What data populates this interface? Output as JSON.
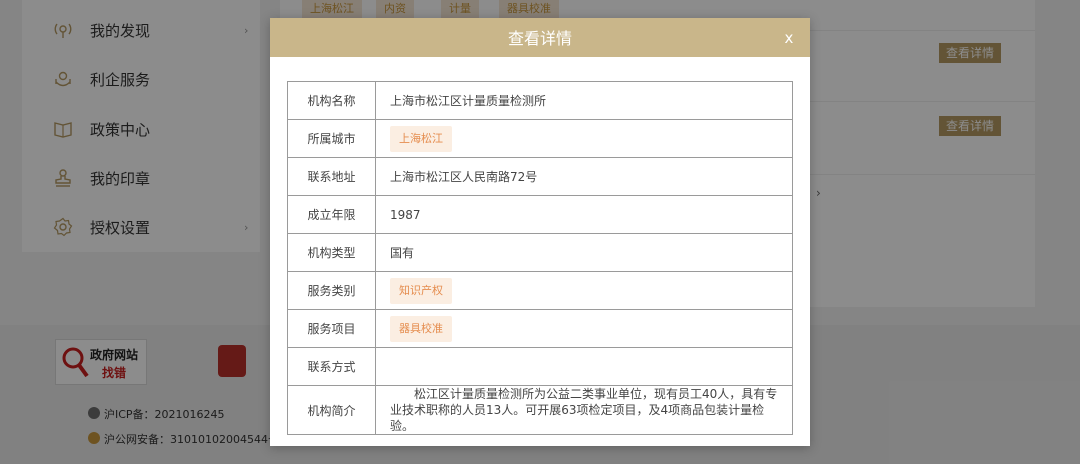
{
  "sidebar": {
    "items": [
      {
        "icon": "discover-icon",
        "label": "我的发现",
        "has_arrow": true
      },
      {
        "icon": "service-icon",
        "label": "利企服务",
        "has_arrow": false
      },
      {
        "icon": "policy-icon",
        "label": "政策中心",
        "has_arrow": false
      },
      {
        "icon": "stamp-icon",
        "label": "我的印章",
        "has_arrow": false
      },
      {
        "icon": "gear-icon",
        "label": "授权设置",
        "has_arrow": true
      }
    ],
    "arrow": "›"
  },
  "background": {
    "tags": [
      "上海松江",
      "内资",
      "计量",
      "器具校准"
    ],
    "detail_buttons": [
      "查看详情",
      "查看详情"
    ],
    "chevron": "›"
  },
  "footer": {
    "gov_badge_line1": "政府网站",
    "gov_badge_line2": "找错",
    "icp": "沪ICP备：2021016245",
    "police": "沪公网安备：31010102004544号"
  },
  "modal": {
    "title": "查看详情",
    "close": "x",
    "rows": [
      {
        "key": "机构名称",
        "value": "上海市松江区计量质量检测所",
        "type": "text"
      },
      {
        "key": "所属城市",
        "value": "上海松江",
        "type": "chip"
      },
      {
        "key": "联系地址",
        "value": "上海市松江区人民南路72号",
        "type": "text"
      },
      {
        "key": "成立年限",
        "value": "1987",
        "type": "text"
      },
      {
        "key": "机构类型",
        "value": "国有",
        "type": "text"
      },
      {
        "key": "服务类别",
        "value": "知识产权",
        "type": "chip"
      },
      {
        "key": "服务项目",
        "value": "器具校准",
        "type": "chip"
      },
      {
        "key": "联系方式",
        "value": "",
        "type": "text"
      },
      {
        "key": "机构简介",
        "value": "松江区计量质量检测所为公益二类事业单位，现有员工40人，具有专业技术职称的人员13人。可开展63项检定项目，及4项商品包装计量检验。",
        "type": "desc"
      }
    ]
  },
  "colors": {
    "modal_header": "#c9b68a",
    "detail_button": "#b59a63",
    "chip_bg": "#fbeee2",
    "chip_text": "#e58d4f"
  }
}
